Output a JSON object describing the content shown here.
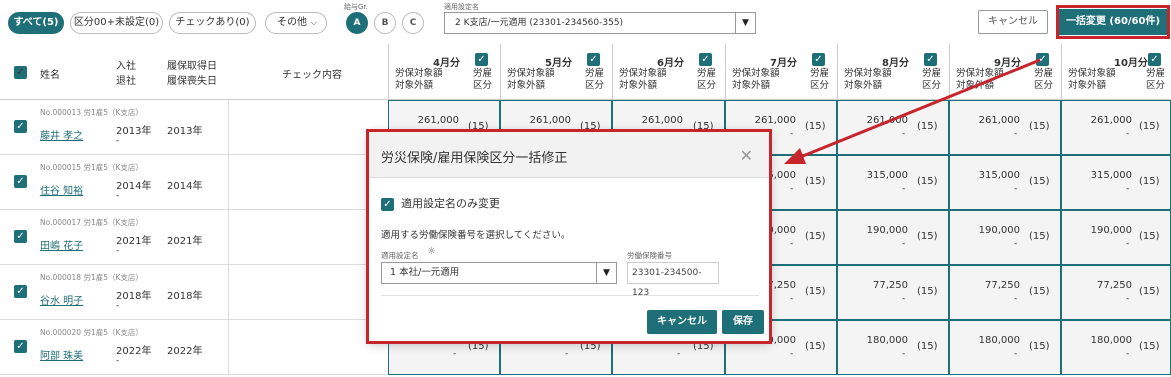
{
  "toolbar": {
    "filters": [
      {
        "label": "すべて(5)",
        "active": true
      },
      {
        "label": "区分00+未設定(0)",
        "active": false
      },
      {
        "label": "チェックあり(0)",
        "active": false
      }
    ],
    "other_label": "その他",
    "gr_label": "給与Gr.",
    "gr_options": [
      "A",
      "B",
      "C"
    ],
    "setting_label": "適用設定名",
    "setting_value": "2 K支店/一元適用 (23301-234560-355)",
    "cancel_label": "キャンセル",
    "bulk_label": "一括変更 (60/60件)"
  },
  "table": {
    "headers": {
      "name": "姓名",
      "join": "入社",
      "leave": "退社",
      "acq": "履保取得日",
      "loss": "履保喪失日",
      "check": "チェック内容"
    },
    "month_sub1a": "労保対象額",
    "month_sub1b": "対象外額",
    "month_sub2a": "労雇",
    "month_sub2b": "区分",
    "months": [
      "4月分",
      "5月分",
      "6月分",
      "7月分",
      "8月分",
      "9月分",
      "10月分"
    ],
    "rows": [
      {
        "no": "No.000013 労1雇5（K支店）",
        "name": "藤井 孝之",
        "join": "2013年",
        "acq": "2013年",
        "amount": "261,000"
      },
      {
        "no": "No.000015 労1雇5（K支店）",
        "name": "住谷 知裕",
        "join": "2014年",
        "acq": "2014年",
        "amount": "315,000"
      },
      {
        "no": "No.000017 労1雇5（K支店）",
        "name": "田嶋 花子",
        "join": "2021年",
        "acq": "2021年",
        "amount": "190,000"
      },
      {
        "no": "No.000018 労1雇5（K支店）",
        "name": "谷水 明子",
        "join": "2018年",
        "acq": "2018年",
        "amount": "77,250"
      },
      {
        "no": "No.000020 労1雇5（K支店）",
        "name": "阿部 珠美",
        "join": "2022年",
        "acq": "2022年",
        "amount": "180,000"
      }
    ],
    "kubun": "(15)",
    "dash": "-"
  },
  "modal": {
    "title": "労災保険/雇用保険区分一括修正",
    "option_label": "適用設定名のみ変更",
    "instruction": "適用する労働保険番号を選択してください。",
    "setting_label": "適用設定名",
    "setting_value": "1 本社/一元適用",
    "number_label": "労働保険番号",
    "number_value": "23301-234500-123",
    "cancel_label": "キャンセル",
    "save_label": "保存"
  },
  "colors": {
    "accent": "#1f6f79",
    "highlight": "#c8242b"
  }
}
